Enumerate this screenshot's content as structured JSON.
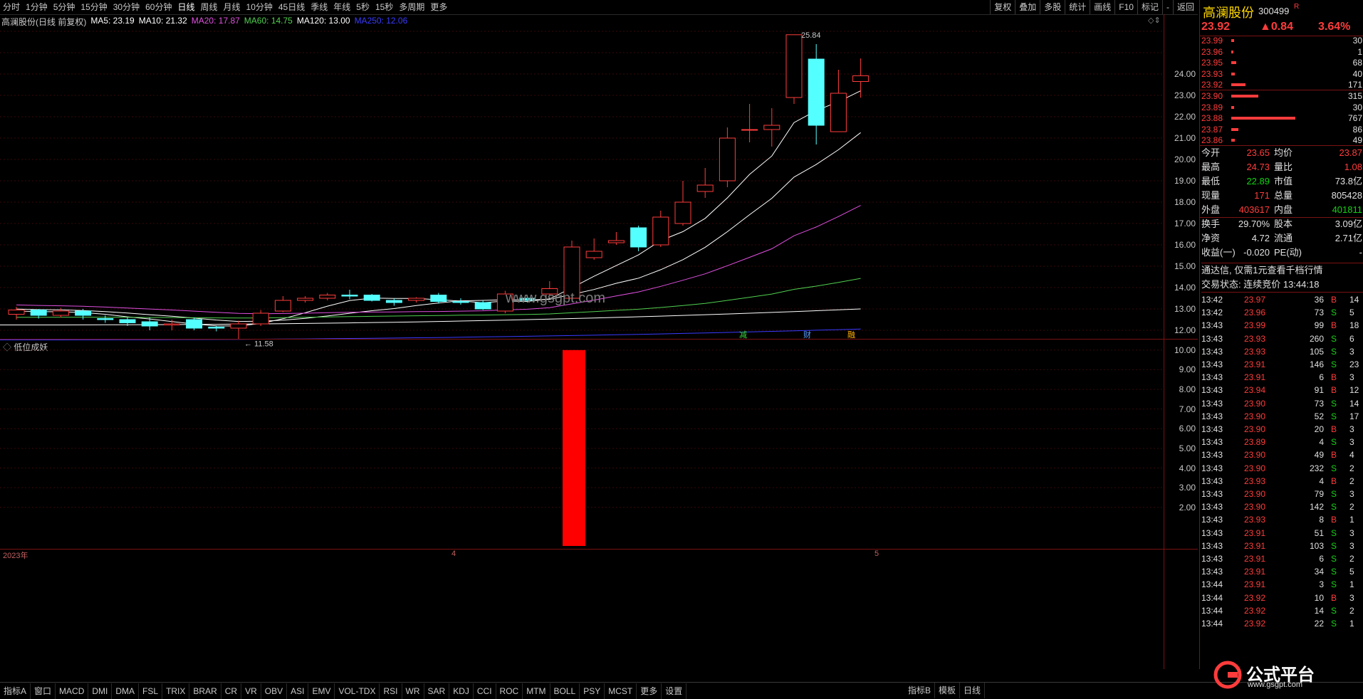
{
  "topbar": {
    "periods": [
      "分时",
      "1分钟",
      "5分钟",
      "15分钟",
      "30分钟",
      "60分钟",
      "日线",
      "周线",
      "月线",
      "10分钟",
      "45日线",
      "季线",
      "年线",
      "5秒",
      "15秒",
      "多周期",
      "更多"
    ],
    "tools": [
      "复权",
      "叠加",
      "多股",
      "统计",
      "画线",
      "F10",
      "标记",
      "-",
      "返回"
    ]
  },
  "chart_title": "高澜股份(日线 前复权)",
  "ma_legend": [
    {
      "label": "MA5: 23.19",
      "color": "#ffffff"
    },
    {
      "label": "MA10: 21.32",
      "color": "#ffffff"
    },
    {
      "label": "MA20: 17.87",
      "color": "#e050e0"
    },
    {
      "label": "MA60: 14.75",
      "color": "#50d050"
    },
    {
      "label": "MA120: 13.00",
      "color": "#ffffff"
    },
    {
      "label": "MA250: 12.06",
      "color": "#3a3aff"
    }
  ],
  "price_axis": [
    "24.00",
    "23.00",
    "22.00",
    "21.00",
    "20.00",
    "19.00",
    "18.00",
    "17.00",
    "16.00",
    "15.00",
    "14.00",
    "13.00",
    "12.00"
  ],
  "indicator_axis": [
    "10.00",
    "9.00",
    "8.00",
    "7.00",
    "6.00",
    "5.00",
    "4.00",
    "3.00",
    "2.00"
  ],
  "indicator_title": "低位成妖",
  "high_label": "25.84",
  "low_label": "11.58",
  "watermark_mid": "www.gsgpt.com",
  "event_marks": [
    "减",
    "财",
    "融"
  ],
  "date_marks": [
    "2023年",
    "4",
    "5"
  ],
  "chart_data": {
    "type": "candlestick",
    "title": "高澜股份(日线 前复权)",
    "candles": [
      {
        "o": 12.75,
        "c": 12.95,
        "h": 13.1,
        "l": 12.5
      },
      {
        "o": 12.95,
        "c": 12.7,
        "h": 13.0,
        "l": 12.55
      },
      {
        "o": 12.7,
        "c": 12.9,
        "h": 13.05,
        "l": 12.6
      },
      {
        "o": 12.9,
        "c": 12.7,
        "h": 13.0,
        "l": 12.5
      },
      {
        "o": 12.55,
        "c": 12.5,
        "h": 12.7,
        "l": 12.35
      },
      {
        "o": 12.5,
        "c": 12.35,
        "h": 12.6,
        "l": 12.2
      },
      {
        "o": 12.4,
        "c": 12.2,
        "h": 12.6,
        "l": 12.0
      },
      {
        "o": 12.25,
        "c": 12.3,
        "h": 12.5,
        "l": 12.0
      },
      {
        "o": 12.5,
        "c": 12.1,
        "h": 12.6,
        "l": 12.0
      },
      {
        "o": 12.15,
        "c": 12.1,
        "h": 12.2,
        "l": 11.95
      },
      {
        "o": 12.1,
        "c": 12.3,
        "h": 12.45,
        "l": 11.58
      },
      {
        "o": 12.3,
        "c": 12.8,
        "h": 12.95,
        "l": 12.2
      },
      {
        "o": 12.9,
        "c": 13.4,
        "h": 13.6,
        "l": 12.85
      },
      {
        "o": 13.4,
        "c": 13.5,
        "h": 13.6,
        "l": 13.3
      },
      {
        "o": 13.5,
        "c": 13.65,
        "h": 13.75,
        "l": 13.4
      },
      {
        "o": 13.65,
        "c": 13.6,
        "h": 13.9,
        "l": 13.45
      },
      {
        "o": 13.65,
        "c": 13.4,
        "h": 13.7,
        "l": 13.35
      },
      {
        "o": 13.4,
        "c": 13.3,
        "h": 13.5,
        "l": 13.15
      },
      {
        "o": 13.4,
        "c": 13.5,
        "h": 13.55,
        "l": 13.3
      },
      {
        "o": 13.65,
        "c": 13.35,
        "h": 13.75,
        "l": 13.25
      },
      {
        "o": 13.35,
        "c": 13.3,
        "h": 13.5,
        "l": 13.2
      },
      {
        "o": 13.3,
        "c": 13.0,
        "h": 13.4,
        "l": 12.95
      },
      {
        "o": 12.9,
        "c": 13.7,
        "h": 13.85,
        "l": 12.8
      },
      {
        "o": 13.5,
        "c": 13.4,
        "h": 13.6,
        "l": 13.3
      },
      {
        "o": 13.7,
        "c": 13.95,
        "h": 14.3,
        "l": 13.6
      },
      {
        "o": 13.5,
        "c": 15.9,
        "h": 16.2,
        "l": 13.4
      },
      {
        "o": 15.4,
        "c": 15.7,
        "h": 16.3,
        "l": 15.3
      },
      {
        "o": 16.1,
        "c": 16.2,
        "h": 16.6,
        "l": 16.0
      },
      {
        "o": 16.8,
        "c": 15.9,
        "h": 16.9,
        "l": 15.7
      },
      {
        "o": 16.0,
        "c": 17.3,
        "h": 17.6,
        "l": 15.9
      },
      {
        "o": 17.0,
        "c": 18.0,
        "h": 19.0,
        "l": 16.9
      },
      {
        "o": 18.5,
        "c": 18.8,
        "h": 19.6,
        "l": 18.2
      },
      {
        "o": 19.0,
        "c": 21.0,
        "h": 21.5,
        "l": 18.7
      },
      {
        "o": 21.4,
        "c": 21.4,
        "h": 22.6,
        "l": 20.8
      },
      {
        "o": 21.4,
        "c": 21.6,
        "h": 22.4,
        "l": 20.6
      },
      {
        "o": 22.9,
        "c": 25.84,
        "h": 25.84,
        "l": 22.6
      },
      {
        "o": 24.7,
        "c": 21.6,
        "h": 25.4,
        "l": 20.7
      },
      {
        "o": 21.3,
        "c": 23.1,
        "h": 24.2,
        "l": 21.3
      },
      {
        "o": 23.65,
        "c": 23.92,
        "h": 24.73,
        "l": 22.89
      }
    ],
    "ma5_end": 23.19,
    "ma10_end": 21.32,
    "ma20_end": 17.87,
    "ma60_end": 14.75,
    "ma120_end": 13.0,
    "ma250_end": 12.06,
    "ylim": [
      11.2,
      26.2
    ],
    "indicator": {
      "name": "低位成妖",
      "bar_index": 25,
      "value": 10.0,
      "ylim": [
        0,
        10.5
      ]
    }
  },
  "quote": {
    "name": "高澜股份",
    "code": "300499",
    "flag": "R",
    "price": "23.92",
    "change": "▲0.84",
    "pct": "3.64%",
    "asks": [
      {
        "p": "23.99",
        "v": "30",
        "w": 0.04
      },
      {
        "p": "23.96",
        "v": "1",
        "w": 0.01
      },
      {
        "p": "23.95",
        "v": "68",
        "w": 0.08
      },
      {
        "p": "23.93",
        "v": "40",
        "w": 0.05
      },
      {
        "p": "23.92",
        "v": "171",
        "w": 0.22
      }
    ],
    "bids": [
      {
        "p": "23.90",
        "v": "315",
        "w": 0.42
      },
      {
        "p": "23.89",
        "v": "30",
        "w": 0.04
      },
      {
        "p": "23.88",
        "v": "767",
        "w": 1.0
      },
      {
        "p": "23.87",
        "v": "86",
        "w": 0.11
      },
      {
        "p": "23.86",
        "v": "49",
        "w": 0.06
      }
    ],
    "stats": [
      {
        "k1": "今开",
        "v1": "23.65",
        "k2": "均价",
        "v2": "23.87",
        "c1": "red",
        "c2": "red"
      },
      {
        "k1": "最高",
        "v1": "24.73",
        "k2": "量比",
        "v2": "1.08",
        "c1": "red",
        "c2": "red"
      },
      {
        "k1": "最低",
        "v1": "22.89",
        "k2": "市值",
        "v2": "73.8亿",
        "c1": "green",
        "c2": "white"
      },
      {
        "k1": "现量",
        "v1": "171",
        "k2": "总量",
        "v2": "805428",
        "c1": "red",
        "c2": "white"
      },
      {
        "k1": "外盘",
        "v1": "403617",
        "k2": "内盘",
        "v2": "401811",
        "c1": "red",
        "c2": "green"
      },
      {
        "k1": "换手",
        "v1": "29.70%",
        "k2": "股本",
        "v2": "3.09亿",
        "c1": "white",
        "c2": "white"
      },
      {
        "k1": "净资",
        "v1": "4.72",
        "k2": "流通",
        "v2": "2.71亿",
        "c1": "white",
        "c2": "white"
      },
      {
        "k1": "收益(一)",
        "v1": "-0.020",
        "k2": "PE(动)",
        "v2": "-",
        "c1": "white",
        "c2": "white"
      }
    ],
    "notice": "通达信, 仅需1元查看千档行情",
    "status": "交易状态: 连续竞价 13:44:18"
  },
  "ticks": [
    {
      "t": "13:42",
      "p": "23.97",
      "v": "36",
      "d": "B",
      "x": "14"
    },
    {
      "t": "13:42",
      "p": "23.96",
      "v": "73",
      "d": "S",
      "x": "5"
    },
    {
      "t": "13:43",
      "p": "23.99",
      "v": "99",
      "d": "B",
      "x": "18"
    },
    {
      "t": "13:43",
      "p": "23.93",
      "v": "260",
      "d": "S",
      "x": "6"
    },
    {
      "t": "13:43",
      "p": "23.93",
      "v": "105",
      "d": "S",
      "x": "3"
    },
    {
      "t": "13:43",
      "p": "23.91",
      "v": "146",
      "d": "S",
      "x": "23"
    },
    {
      "t": "13:43",
      "p": "23.91",
      "v": "6",
      "d": "B",
      "x": "3"
    },
    {
      "t": "13:43",
      "p": "23.94",
      "v": "91",
      "d": "B",
      "x": "12"
    },
    {
      "t": "13:43",
      "p": "23.90",
      "v": "73",
      "d": "S",
      "x": "14"
    },
    {
      "t": "13:43",
      "p": "23.90",
      "v": "52",
      "d": "S",
      "x": "17"
    },
    {
      "t": "13:43",
      "p": "23.90",
      "v": "20",
      "d": "B",
      "x": "3"
    },
    {
      "t": "13:43",
      "p": "23.89",
      "v": "4",
      "d": "S",
      "x": "3"
    },
    {
      "t": "13:43",
      "p": "23.90",
      "v": "49",
      "d": "B",
      "x": "4"
    },
    {
      "t": "13:43",
      "p": "23.90",
      "v": "232",
      "d": "S",
      "x": "2"
    },
    {
      "t": "13:43",
      "p": "23.93",
      "v": "4",
      "d": "B",
      "x": "2"
    },
    {
      "t": "13:43",
      "p": "23.90",
      "v": "79",
      "d": "S",
      "x": "3"
    },
    {
      "t": "13:43",
      "p": "23.90",
      "v": "142",
      "d": "S",
      "x": "2"
    },
    {
      "t": "13:43",
      "p": "23.93",
      "v": "8",
      "d": "B",
      "x": "1"
    },
    {
      "t": "13:43",
      "p": "23.91",
      "v": "51",
      "d": "S",
      "x": "3"
    },
    {
      "t": "13:43",
      "p": "23.91",
      "v": "103",
      "d": "S",
      "x": "3"
    },
    {
      "t": "13:43",
      "p": "23.91",
      "v": "6",
      "d": "S",
      "x": "2"
    },
    {
      "t": "13:43",
      "p": "23.91",
      "v": "34",
      "d": "S",
      "x": "5"
    },
    {
      "t": "13:44",
      "p": "23.91",
      "v": "3",
      "d": "S",
      "x": "1"
    },
    {
      "t": "13:44",
      "p": "23.92",
      "v": "10",
      "d": "B",
      "x": "3"
    },
    {
      "t": "13:44",
      "p": "23.92",
      "v": "14",
      "d": "S",
      "x": "2"
    },
    {
      "t": "13:44",
      "p": "23.92",
      "v": "22",
      "d": "S",
      "x": "1"
    }
  ],
  "bottom_tabs": [
    "指标A",
    "窗口",
    "MACD",
    "DMI",
    "DMA",
    "FSL",
    "TRIX",
    "BRAR",
    "CR",
    "VR",
    "OBV",
    "ASI",
    "EMV",
    "VOL-TDX",
    "RSI",
    "WR",
    "SAR",
    "KDJ",
    "CCI",
    "ROC",
    "MTM",
    "BOLL",
    "PSY",
    "MCST",
    "更多",
    "设置"
  ],
  "bottom_right": [
    "指标B",
    "模板",
    "日线"
  ],
  "brand": {
    "name": "公式平台",
    "url": "www.gsgpt.com"
  }
}
